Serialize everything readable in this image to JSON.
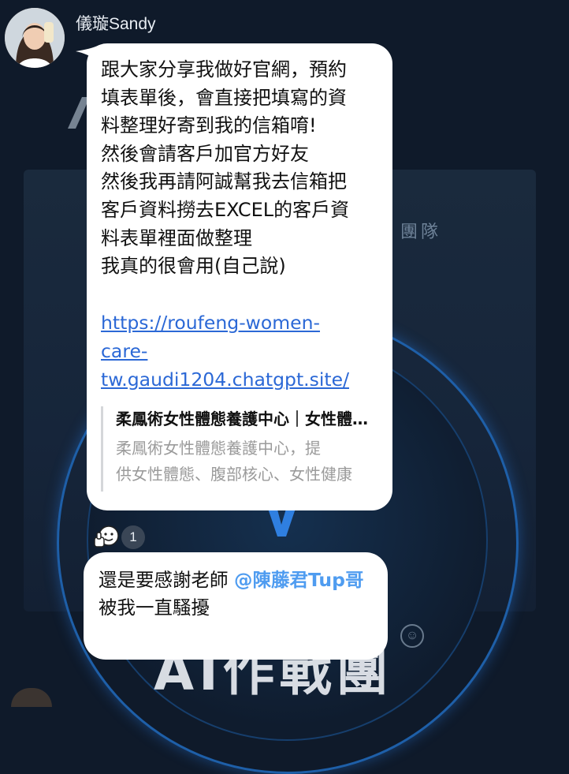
{
  "background": {
    "team_text": "團隊",
    "title_text": "AI作戰團"
  },
  "chat": {
    "sender_name": "儀璇Sandy",
    "message1": {
      "text": "跟大家分享我做好官網，預約\n填表單後，會直接把填寫的資\n料整理好寄到我的信箱唷!\n然後會請客戶加官方好友\n然後我再請阿誠幫我去信箱把\n客戶資料撈去EXCEL的客戶資\n料表單裡面做整理\n我真的很會用(自己說)",
      "link": "https://roufeng-women-\ncare-\ntw.gaudi1204.chatgpt.site/",
      "preview_title": "柔鳳術女性體態養護中心｜女性體態養護",
      "preview_desc_line1": "柔鳳術女性體態養護中心，提",
      "preview_desc_line2": "供女性體態、腹部核心、女性健康"
    },
    "reaction": {
      "emoji": "thumbs-up-face",
      "count": "1"
    },
    "message2": {
      "prefix": "還是要感謝老師 ",
      "mention": "@陳藤君Tup哥",
      "suffix": "被我一直騷擾"
    }
  },
  "colors": {
    "bubble": "#ffffff",
    "link": "#2b68d6",
    "mention": "#4f9cf0",
    "background": "#0f1a2a"
  }
}
